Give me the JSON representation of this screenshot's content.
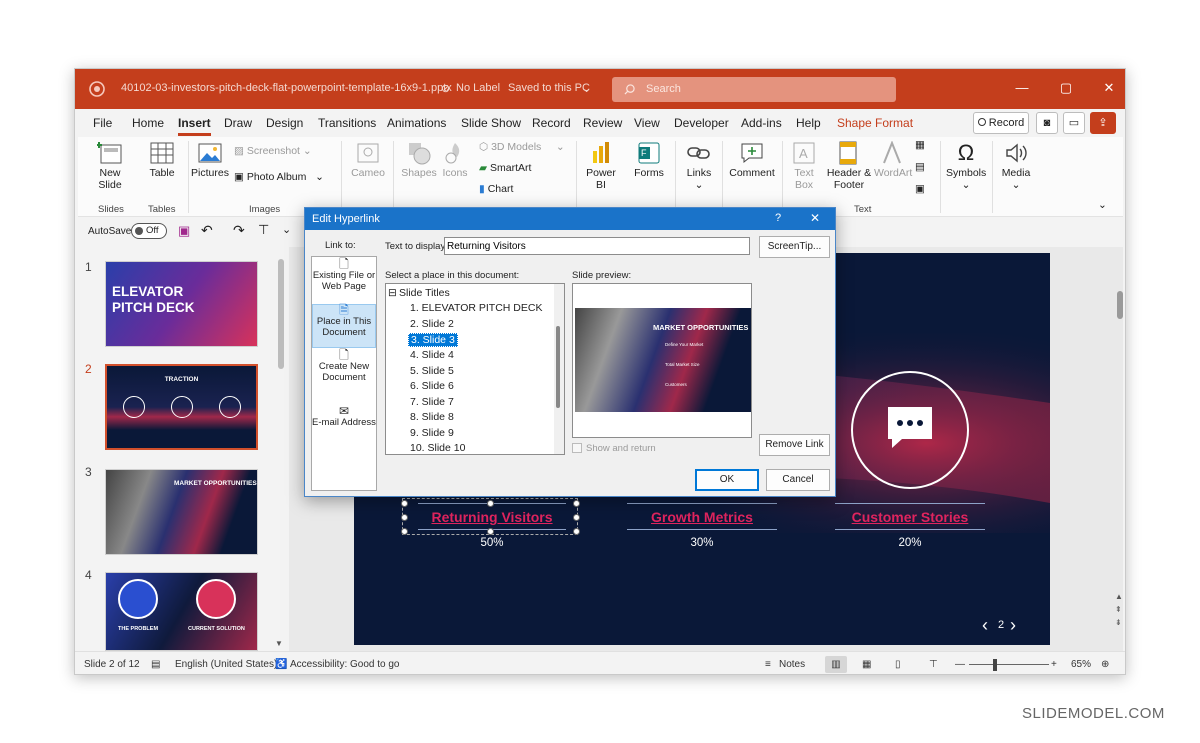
{
  "window": {
    "filename": "40102-03-investors-pitch-deck-flat-powerpoint-template-16x9-1.pptx",
    "label": "No Label",
    "saved": "Saved to this PC",
    "search_placeholder": "Search"
  },
  "menu_tabs": [
    "File",
    "Home",
    "Insert",
    "Draw",
    "Design",
    "Transitions",
    "Animations",
    "Slide Show",
    "Record",
    "Review",
    "View",
    "Developer",
    "Add-ins",
    "Help",
    "Shape Format"
  ],
  "active_tab": "Insert",
  "record_label": "Record",
  "ribbon": {
    "new_slide": "New Slide",
    "table": "Table",
    "pictures": "Pictures",
    "screenshot": "Screenshot",
    "photo_album": "Photo Album",
    "cameo": "Cameo",
    "shapes": "Shapes",
    "icons": "Icons",
    "models3d": "3D Models",
    "smartart": "SmartArt",
    "chart": "Chart",
    "powerbi": "Power BI",
    "forms": "Forms",
    "links": "Links",
    "comment": "Comment",
    "textbox": "Text Box",
    "header_footer": "Header & Footer",
    "wordart": "WordArt",
    "symbols": "Symbols",
    "media": "Media",
    "groups": {
      "slides": "Slides",
      "tables": "Tables",
      "images": "Images",
      "text": "Text"
    }
  },
  "qat": {
    "autosave": "AutoSave",
    "toggle": "Off"
  },
  "thumbs": [
    {
      "num": "1",
      "title": "ELEVATOR PITCH DECK"
    },
    {
      "num": "2",
      "title": "TRACTION"
    },
    {
      "num": "3",
      "title": "MARKET OPPORTUNITIES"
    },
    {
      "num": "4",
      "title_left": "THE PROBLEM",
      "title_right": "CURRENT SOLUTION"
    }
  ],
  "slide": {
    "stats": [
      {
        "label": "Returning Visitors",
        "value": "50%"
      },
      {
        "label": "Growth Metrics",
        "value": "30%"
      },
      {
        "label": "Customer Stories",
        "value": "20%"
      }
    ],
    "page": "2"
  },
  "dialog": {
    "title": "Edit Hyperlink",
    "help": "?",
    "link_to": "Link to:",
    "text_to_display_label": "Text to display:",
    "text_to_display_value": "Returning Visitors",
    "screentip": "ScreenTip...",
    "select_place": "Select a place in this document:",
    "slide_preview": "Slide preview:",
    "nav": [
      "Existing File or Web Page",
      "Place in This Document",
      "Create New Document",
      "E-mail Address"
    ],
    "tree_root": "Slide Titles",
    "items": [
      "1. ELEVATOR PITCH DECK",
      "2. Slide 2",
      "3. Slide 3",
      "4. Slide 4",
      "5. Slide 5",
      "6. Slide 6",
      "7. Slide 7",
      "8. Slide 8",
      "9. Slide 9",
      "10. Slide 10"
    ],
    "selected_index": 2,
    "preview_title": "MARKET OPPORTUNITIES",
    "preview_lines": [
      "Define Your Market",
      "Total Market Size",
      "Customers"
    ],
    "show_and_return": "Show and return",
    "remove_link": "Remove Link",
    "ok": "OK",
    "cancel": "Cancel"
  },
  "status": {
    "slide": "Slide 2 of 12",
    "language": "English (United States)",
    "accessibility": "Accessibility: Good to go",
    "notes": "Notes",
    "zoom": "65%"
  },
  "watermark": "SLIDEMODEL.COM",
  "colors": {
    "accent": "#c43e1c",
    "link": "#e0245e",
    "dialog_blue": "#1a73c9",
    "slide_bg": "#0a1838"
  }
}
